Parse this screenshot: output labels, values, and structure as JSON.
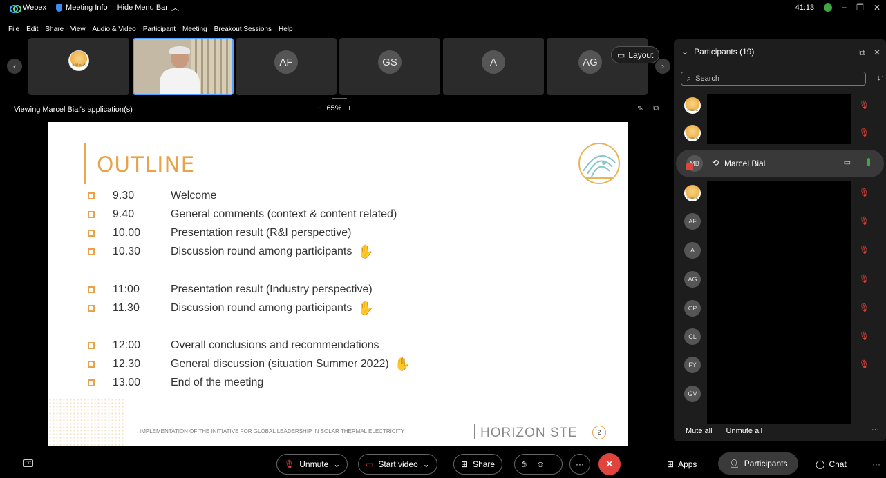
{
  "titlebar": {
    "app_name": "Webex",
    "meeting_info": "Meeting Info",
    "hide_menu_bar": "Hide Menu Bar",
    "timer": "41:13"
  },
  "menu": {
    "items": [
      "File",
      "Edit",
      "Share",
      "View",
      "Audio & Video",
      "Participant",
      "Meeting",
      "Breakout Sessions",
      "Help"
    ]
  },
  "thumbnails": [
    {
      "type": "logo",
      "label": "ESTELA"
    },
    {
      "type": "video",
      "label": ""
    },
    {
      "type": "initials",
      "label": "AF"
    },
    {
      "type": "initials",
      "label": "GS"
    },
    {
      "type": "initials",
      "label": "A"
    },
    {
      "type": "initials",
      "label": "AG"
    }
  ],
  "layout_button": "Layout",
  "viewing": {
    "label": "Viewing Marcel Bial's application(s)",
    "zoom": "65%",
    "zoom_minus": "−",
    "zoom_plus": "+"
  },
  "slide": {
    "title": "OUTLINE",
    "agenda": [
      {
        "time": "9.30",
        "text": "Welcome",
        "hand": false
      },
      {
        "time": "9.40",
        "text": "General comments (context & content related)",
        "hand": false
      },
      {
        "time": "10.00",
        "text": "Presentation result (R&I perspective)",
        "hand": false
      },
      {
        "time": "10.30",
        "text": "Discussion round among participants",
        "hand": true
      },
      {
        "time": "11:00",
        "text": "Presentation result (Industry perspective)",
        "hand": false
      },
      {
        "time": "11.30",
        "text": "Discussion round among participants",
        "hand": true
      },
      {
        "time": "12:00",
        "text": "Overall conclusions and recommendations",
        "hand": false
      },
      {
        "time": "12.30",
        "text": "General discussion (situation Summer 2022)",
        "hand": true
      },
      {
        "time": "13.00",
        "text": "End of the meeting",
        "hand": false
      }
    ],
    "footer": "IMPLEMENTATION OF THE INITIATIVE FOR GLOBAL LEADERSHIP IN SOLAR THERMAL ELECTRICITY",
    "brand": "HORIZON STE",
    "page": "2"
  },
  "participants": {
    "title": "Participants (19)",
    "search_placeholder": "Search",
    "highlighted": {
      "initials": "MB",
      "name": "Marcel Bial"
    },
    "rows": [
      {
        "avatar": "logo",
        "initials": "ESTELA"
      },
      {
        "avatar": "logo",
        "initials": "ESTELA"
      },
      {
        "avatar": "highlight",
        "initials": "MB"
      },
      {
        "avatar": "logo",
        "initials": "ESTELA"
      },
      {
        "avatar": "initials",
        "initials": "AF"
      },
      {
        "avatar": "initials",
        "initials": "A"
      },
      {
        "avatar": "initials",
        "initials": "AG"
      },
      {
        "avatar": "initials",
        "initials": "CP"
      },
      {
        "avatar": "initials",
        "initials": "CL"
      },
      {
        "avatar": "initials",
        "initials": "FY"
      },
      {
        "avatar": "initials",
        "initials": "GV"
      }
    ],
    "mute_all": "Mute all",
    "unmute_all": "Unmute all"
  },
  "controls": {
    "unmute": "Unmute",
    "start_video": "Start video",
    "share": "Share",
    "apps": "Apps",
    "participants": "Participants",
    "chat": "Chat"
  },
  "colors": {
    "accent_orange": "#e8a24a",
    "mute_red": "#e0443c",
    "active_blue": "#4fa3ff"
  }
}
